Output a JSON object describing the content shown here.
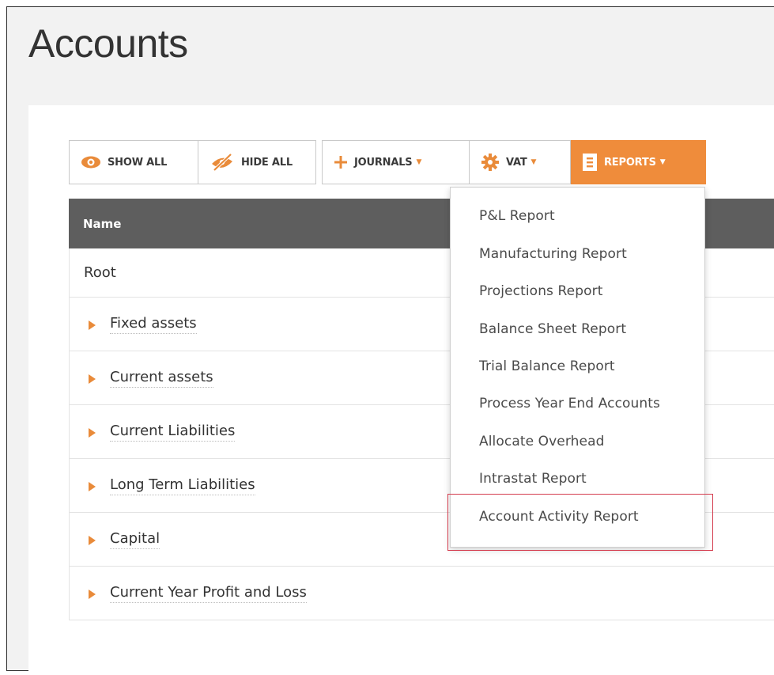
{
  "page": {
    "title": "Accounts"
  },
  "toolbar": {
    "show_all": "SHOW ALL",
    "hide_all": "HIDE ALL",
    "journals": "JOURNALS",
    "vat": "VAT",
    "reports": "REPORTS"
  },
  "table": {
    "header_name": "Name",
    "root_label": "Root",
    "rows": [
      {
        "label": "Fixed assets"
      },
      {
        "label": "Current assets"
      },
      {
        "label": "Current Liabilities"
      },
      {
        "label": "Long Term Liabilities"
      },
      {
        "label": "Capital"
      },
      {
        "label": "Current Year Profit and Loss"
      }
    ]
  },
  "reports_menu": {
    "items": [
      {
        "label": "P&L Report"
      },
      {
        "label": "Manufacturing Report"
      },
      {
        "label": "Projections Report"
      },
      {
        "label": "Balance Sheet Report"
      },
      {
        "label": "Trial Balance Report"
      },
      {
        "label": "Process Year End Accounts"
      },
      {
        "label": "Allocate Overhead"
      },
      {
        "label": "Intrastat Report"
      },
      {
        "label": "Account Activity Report"
      }
    ],
    "highlighted_item": "Account Activity Report"
  },
  "icons": {
    "show_all": "eye-icon",
    "hide_all": "eye-slash-icon",
    "journals": "plus-icon",
    "vat": "gear-icon",
    "reports": "document-icon",
    "expand": "expand-arrow-icon"
  },
  "colors": {
    "accent": "#ef8c3b",
    "header_bg": "#5e5e5e",
    "highlight": "#d43c4e"
  }
}
